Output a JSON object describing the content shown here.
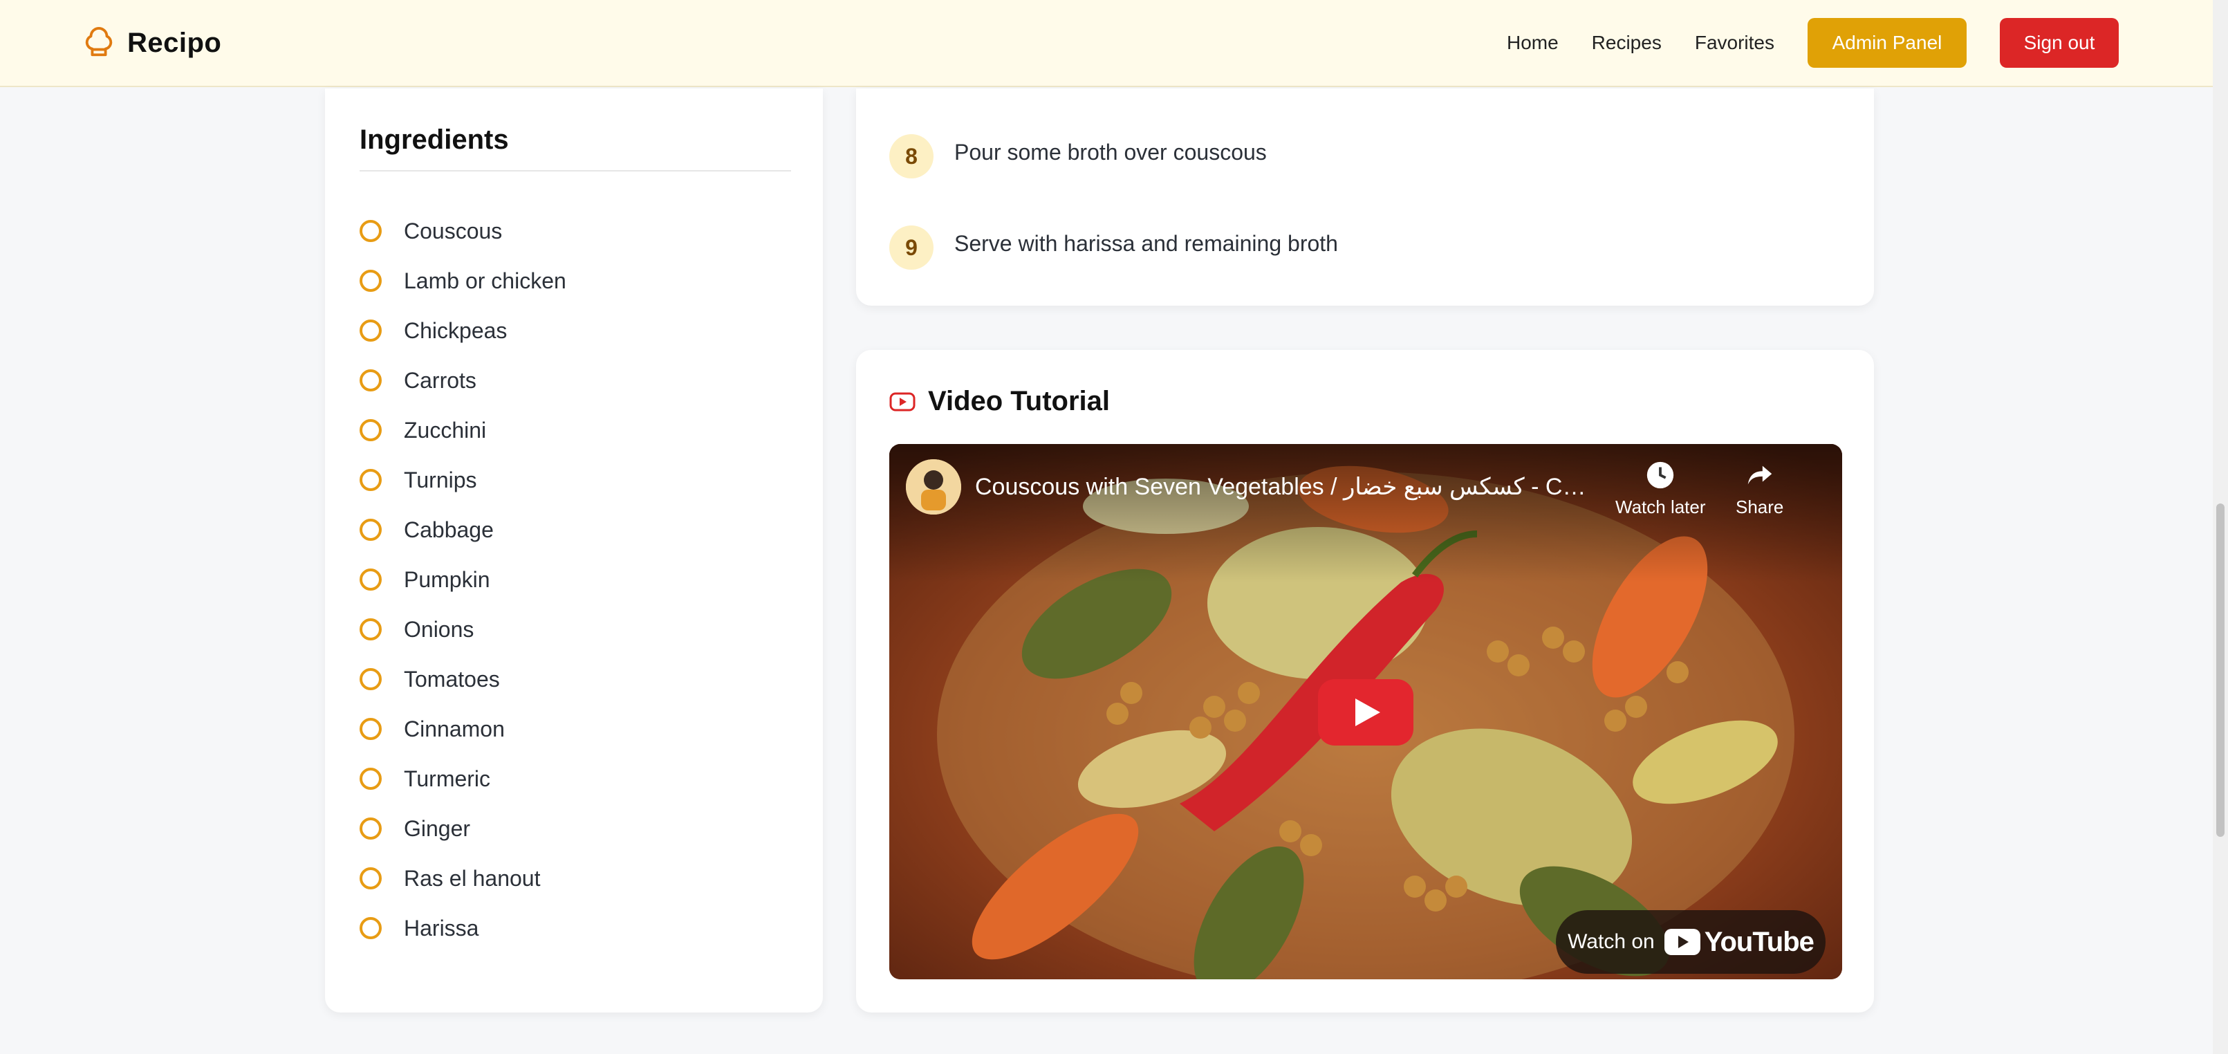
{
  "brand": {
    "name": "Recipo",
    "icon": "chef-hat-icon"
  },
  "nav": {
    "links": [
      "Home",
      "Recipes",
      "Favorites"
    ],
    "admin_label": "Admin Panel",
    "signout_label": "Sign out"
  },
  "ingredients": {
    "title": "Ingredients",
    "items": [
      "Couscous",
      "Lamb or chicken",
      "Chickpeas",
      "Carrots",
      "Zucchini",
      "Turnips",
      "Cabbage",
      "Pumpkin",
      "Onions",
      "Tomatoes",
      "Cinnamon",
      "Turmeric",
      "Ginger",
      "Ras el hanout",
      "Harissa"
    ]
  },
  "steps": [
    {
      "number": "8",
      "text": "Pour some broth over couscous"
    },
    {
      "number": "9",
      "text": "Serve with harissa and remaining broth"
    }
  ],
  "video": {
    "section_title": "Video Tutorial",
    "title": "Couscous with Seven Vegetables / كسكس سبع خضار - Coo...",
    "watch_later_label": "Watch later",
    "share_label": "Share",
    "watch_on_label": "Watch on",
    "youtube_label": "YouTube"
  },
  "colors": {
    "accent": "#e0a106",
    "danger": "#dc2626",
    "header_bg": "#fffbea",
    "checkbox": "#e89c14"
  }
}
